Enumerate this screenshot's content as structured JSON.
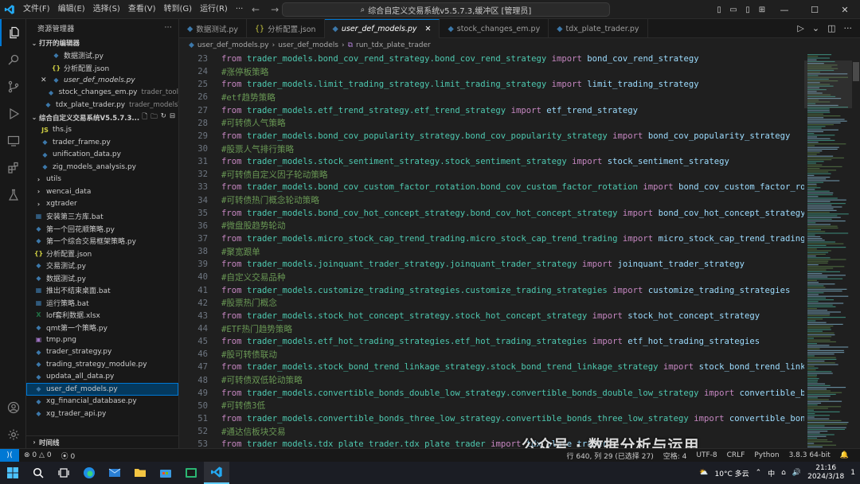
{
  "titlebar": {
    "menu": [
      "文件(F)",
      "编辑(E)",
      "选择(S)",
      "查看(V)",
      "转到(G)",
      "运行(R)",
      "···"
    ],
    "search_text": "综合自定义交易系统v5.5.7.3,缓冲区 [管理员]"
  },
  "sidebar": {
    "title": "资源管理器",
    "open_editors_label": "打开的编辑器",
    "open_editors": [
      {
        "name": "数据测试.py",
        "icon": "python-file-icon",
        "hint": ""
      },
      {
        "name": "分析配置.json",
        "icon": "json-file-icon",
        "hint": ""
      },
      {
        "name": "user_def_models.py",
        "icon": "python-file-icon",
        "hint": ""
      },
      {
        "name": "stock_changes_em.py",
        "icon": "python-file-icon",
        "hint": "trader_tool"
      },
      {
        "name": "tdx_plate_trader.py",
        "icon": "python-file-icon",
        "hint": "trader_models\\..."
      }
    ],
    "workspace_label": "综合自定义交易系统V5.5.7.3...",
    "tree": [
      {
        "name": "ths.js",
        "icon": "js-file-icon",
        "indent": 1
      },
      {
        "name": "trader_frame.py",
        "icon": "python-file-icon",
        "indent": 1
      },
      {
        "name": "unification_data.py",
        "icon": "python-file-icon",
        "indent": 1
      },
      {
        "name": "zig_models_analysis.py",
        "icon": "python-file-icon",
        "indent": 1
      },
      {
        "name": "utils",
        "icon": "folder-icon",
        "indent": 0
      },
      {
        "name": "wencai_data",
        "icon": "folder-icon",
        "indent": 0
      },
      {
        "name": "xgtrader",
        "icon": "folder-icon",
        "indent": 0
      },
      {
        "name": "安装第三方库.bat",
        "icon": "bat-file-icon",
        "indent": 0
      },
      {
        "name": "第一个回花顺策略.py",
        "icon": "python-file-icon",
        "indent": 0
      },
      {
        "name": "第一个综合交易框架策略.py",
        "icon": "python-file-icon",
        "indent": 0
      },
      {
        "name": "分析配置.json",
        "icon": "json-file-icon",
        "indent": 0
      },
      {
        "name": "交易测试.py",
        "icon": "python-file-icon",
        "indent": 0
      },
      {
        "name": "数据测试.py",
        "icon": "python-file-icon",
        "indent": 0
      },
      {
        "name": "推出不结束桌面.bat",
        "icon": "bat-file-icon",
        "indent": 0
      },
      {
        "name": "运行策略.bat",
        "icon": "bat-file-icon",
        "indent": 0
      },
      {
        "name": "lof套利数据.xlsx",
        "icon": "excel-file-icon",
        "indent": 0
      },
      {
        "name": "qmt第一个策略.py",
        "icon": "python-file-icon",
        "indent": 0
      },
      {
        "name": "tmp.png",
        "icon": "image-file-icon",
        "indent": 0
      },
      {
        "name": "trader_strategy.py",
        "icon": "python-file-icon",
        "indent": 0
      },
      {
        "name": "trading_strategy_module.py",
        "icon": "python-file-icon",
        "indent": 0
      },
      {
        "name": "updata_all_data.py",
        "icon": "python-file-icon",
        "indent": 0
      },
      {
        "name": "user_def_models.py",
        "icon": "python-file-icon",
        "indent": 0,
        "selected": true
      },
      {
        "name": "xg_financial_database.py",
        "icon": "python-file-icon",
        "indent": 0
      },
      {
        "name": "xg_trader_api.py",
        "icon": "python-file-icon",
        "indent": 0
      }
    ],
    "timeline_label": "时间线"
  },
  "tabs": [
    {
      "label": "数据测试.py",
      "active": false
    },
    {
      "label": "分析配置.json",
      "active": false
    },
    {
      "label": "user_def_models.py",
      "active": true
    },
    {
      "label": "stock_changes_em.py",
      "active": false
    },
    {
      "label": "tdx_plate_trader.py",
      "active": false
    }
  ],
  "breadcrumb": [
    "user_def_models.py",
    "user_def_models",
    "run_tdx_plate_trader"
  ],
  "code_lines": [
    {
      "n": "23",
      "t": "import",
      "pkg": "trader_models.bond_cov_rend_strategy.bond_cov_rend_strategy",
      "name": "bond_cov_rend_strategy"
    },
    {
      "n": "24",
      "t": "comment",
      "text": "#涨停板策略"
    },
    {
      "n": "25",
      "t": "import",
      "pkg": "trader_models.limit_trading_strategy.limit_trading_strategy",
      "name": "limit_trading_strategy"
    },
    {
      "n": "26",
      "t": "comment",
      "text": "#etf趋势策略"
    },
    {
      "n": "27",
      "t": "import",
      "pkg": "trader_models.etf_trend_strategy.etf_trend_strategy",
      "name": "etf_trend_strategy"
    },
    {
      "n": "28",
      "t": "comment",
      "text": "#可转债人气策略"
    },
    {
      "n": "29",
      "t": "import",
      "pkg": "trader_models.bond_cov_popularity_strategy.bond_cov_popularity_strategy",
      "name": "bond_cov_popularity_strategy"
    },
    {
      "n": "30",
      "t": "comment",
      "text": "#股票人气排行策略"
    },
    {
      "n": "31",
      "t": "import",
      "pkg": "trader_models.stock_sentiment_strategy.stock_sentiment_strategy",
      "name": "stock_sentiment_strategy"
    },
    {
      "n": "32",
      "t": "comment",
      "text": "#可转债自定义因子轮动策略"
    },
    {
      "n": "33",
      "t": "import",
      "pkg": "trader_models.bond_cov_custom_factor_rotation.bond_cov_custom_factor_rotation",
      "name": "bond_cov_custom_factor_rotation"
    },
    {
      "n": "34",
      "t": "comment",
      "text": "#可转债热门概念轮动策略"
    },
    {
      "n": "35",
      "t": "import",
      "pkg": "trader_models.bond_cov_hot_concept_strategy.bond_cov_hot_concept_strategy",
      "name": "bond_cov_hot_concept_strategy"
    },
    {
      "n": "36",
      "t": "comment",
      "text": "#微盘股趋势轮动"
    },
    {
      "n": "37",
      "t": "import",
      "pkg": "trader_models.micro_stock_cap_trend_trading.micro_stock_cap_trend_trading",
      "name": "micro_stock_cap_trend_trading"
    },
    {
      "n": "38",
      "t": "comment",
      "text": "#聚宽跟单"
    },
    {
      "n": "39",
      "t": "import",
      "pkg": "trader_models.joinquant_trader_strategy.joinquant_trader_strategy",
      "name": "joinquant_trader_strategy"
    },
    {
      "n": "40",
      "t": "comment",
      "text": "#自定义交易品种"
    },
    {
      "n": "41",
      "t": "import",
      "pkg": "trader_models.customize_trading_strategies.customize_trading_strategies",
      "name": "customize_trading_strategies"
    },
    {
      "n": "42",
      "t": "comment",
      "text": "#股票热门概念"
    },
    {
      "n": "43",
      "t": "import",
      "pkg": "trader_models.stock_hot_concept_strategy.stock_hot_concept_strategy",
      "name": "stock_hot_concept_strategy"
    },
    {
      "n": "44",
      "t": "comment",
      "text": "#ETF热门趋势策略"
    },
    {
      "n": "45",
      "t": "import",
      "pkg": "trader_models.etf_hot_trading_strategies.etf_hot_trading_strategies",
      "name": "etf_hot_trading_strategies"
    },
    {
      "n": "46",
      "t": "comment",
      "text": "#股可转债联动"
    },
    {
      "n": "47",
      "t": "import",
      "pkg": "trader_models.stock_bond_trend_linkage_strategy.stock_bond_trend_linkage_strategy",
      "name": "stock_bond_trend_linkage_strategy"
    },
    {
      "n": "48",
      "t": "comment",
      "text": "#可转债双低轮动策略"
    },
    {
      "n": "49",
      "t": "import",
      "pkg": "trader_models.convertible_bonds_double_low_strategy.convertible_bonds_double_low_strategy",
      "name": "convertible_bonds_double_low_strategy"
    },
    {
      "n": "50",
      "t": "comment",
      "text": "#可转债3低"
    },
    {
      "n": "51",
      "t": "import",
      "pkg": "trader_models.convertible_bonds_three_low_strategy.convertible_bonds_three_low_strategy",
      "name": "convertible_bonds_three_low_strategy"
    },
    {
      "n": "52",
      "t": "comment",
      "text": "#通达信板块交易"
    },
    {
      "n": "53",
      "t": "import",
      "pkg": "trader_models.tdx_plate_trader.tdx_plate_trader",
      "name": "tdx_plate_trader"
    }
  ],
  "keywords": {
    "from": "from",
    "import": "import"
  },
  "statusbar": {
    "errors": "0",
    "warnings": "0",
    "ports": "0",
    "position": "行 640, 列 29 (已选择 27)",
    "spaces": "空格: 4",
    "encoding": "UTF-8",
    "eol": "CRLF",
    "language": "Python",
    "python_version": "3.8.3 64-bit"
  },
  "taskbar": {
    "weather": "10°C 多云",
    "ime": "中",
    "time": "21:16",
    "date": "2024/3/18",
    "notifications": "1"
  },
  "watermark": "公众号 · 数据分析与运用",
  "colors": {
    "accent": "#0078d4",
    "keyword": "#c586c0",
    "module": "#4ec9b0",
    "name": "#9cdcfe",
    "comment": "#6a9955"
  }
}
